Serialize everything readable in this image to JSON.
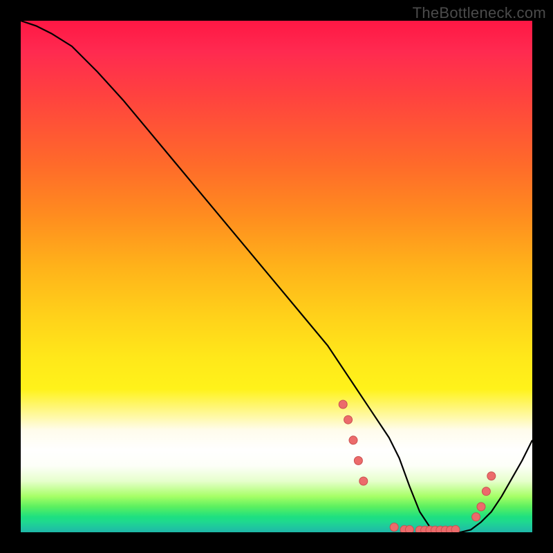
{
  "watermark": "TheBottleneck.com",
  "colors": {
    "curve_stroke": "#000000",
    "dot_fill": "#ec6b6b",
    "dot_stroke": "#c94f4f"
  },
  "chart_data": {
    "type": "line",
    "title": "",
    "xlabel": "",
    "ylabel": "",
    "xlim": [
      0,
      100
    ],
    "ylim": [
      0,
      100
    ],
    "grid": false,
    "legend": false,
    "series": [
      {
        "name": "bottleneck-curve",
        "x": [
          0,
          3,
          6,
          10,
          15,
          20,
          25,
          30,
          35,
          40,
          45,
          50,
          55,
          60,
          62,
          64,
          66,
          68,
          70,
          72,
          74,
          76,
          78,
          80,
          82,
          84,
          86,
          88,
          90,
          92,
          94,
          96,
          98,
          100
        ],
        "y": [
          100,
          99,
          97.5,
          95,
          90,
          84.5,
          78.5,
          72.5,
          66.5,
          60.5,
          54.5,
          48.5,
          42.5,
          36.5,
          33.5,
          30.5,
          27.5,
          24.5,
          21.5,
          18.5,
          14.5,
          9,
          4,
          1,
          0,
          0,
          0,
          0.5,
          2,
          4,
          7,
          10.5,
          14,
          18
        ]
      }
    ],
    "dots": [
      {
        "x": 63,
        "y": 25
      },
      {
        "x": 64,
        "y": 22
      },
      {
        "x": 65,
        "y": 18
      },
      {
        "x": 66,
        "y": 14
      },
      {
        "x": 67,
        "y": 10
      },
      {
        "x": 73,
        "y": 1
      },
      {
        "x": 75,
        "y": 0.5
      },
      {
        "x": 76,
        "y": 0.5
      },
      {
        "x": 78,
        "y": 0.4
      },
      {
        "x": 79,
        "y": 0.4
      },
      {
        "x": 80,
        "y": 0.4
      },
      {
        "x": 81,
        "y": 0.4
      },
      {
        "x": 82,
        "y": 0.4
      },
      {
        "x": 83,
        "y": 0.4
      },
      {
        "x": 84,
        "y": 0.4
      },
      {
        "x": 85,
        "y": 0.5
      },
      {
        "x": 89,
        "y": 3
      },
      {
        "x": 90,
        "y": 5
      },
      {
        "x": 91,
        "y": 8
      },
      {
        "x": 92,
        "y": 11
      }
    ]
  }
}
